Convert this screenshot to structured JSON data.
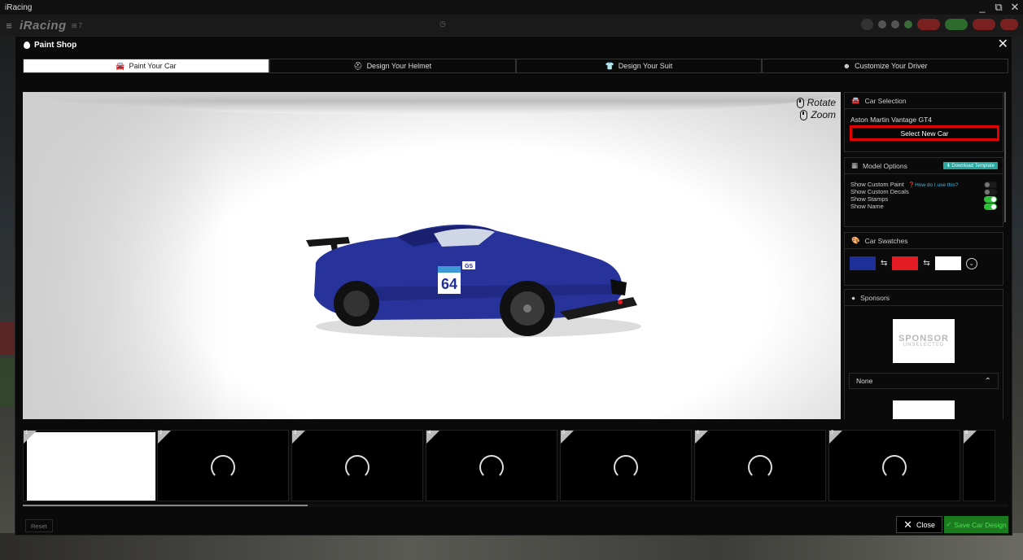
{
  "os_window": {
    "title": "iRacing",
    "minimize": "_",
    "restore": "⧉",
    "close": "✕"
  },
  "nav": {
    "logo": "iRacing",
    "logo_badge": "⊞ 7"
  },
  "modal": {
    "title": "Paint Shop",
    "close": "✕"
  },
  "tabs": [
    {
      "label": "Paint Your Car",
      "icon": "🚘",
      "active": true
    },
    {
      "label": "Design Your Helmet",
      "icon": "⛑",
      "active": false
    },
    {
      "label": "Design Your Suit",
      "icon": "👕",
      "active": false
    },
    {
      "label": "Customize Your Driver",
      "icon": "☻",
      "active": false
    }
  ],
  "viewport": {
    "rotate_label": "Rotate",
    "zoom_label": "Zoom",
    "car_number": "64",
    "car_badge": "GS"
  },
  "car_selection": {
    "header": "Car Selection",
    "car_name": "Aston Martin Vantage GT4",
    "select_button": "Select New Car"
  },
  "model_options": {
    "header": "Model Options",
    "download_template": "⬇ Download Template",
    "help_link": "How do I use this?",
    "options": [
      {
        "label": "Show Custom Paint",
        "on": false
      },
      {
        "label": "Show Custom Decals",
        "on": false
      },
      {
        "label": "Show Stamps",
        "on": true
      },
      {
        "label": "Show Name",
        "on": true
      }
    ]
  },
  "car_swatches": {
    "header": "Car Swatches",
    "colors": [
      "#1f2f9a",
      "#e51b24",
      "#ffffff"
    ],
    "swap": "⇆",
    "dropdown": "⌄"
  },
  "sponsors": {
    "header": "Sponsors",
    "placeholder_text": "SPONSOR",
    "placeholder_sub": "UNSELECTED",
    "selected": "None",
    "chevron": "⌃"
  },
  "thumbnails": [
    {
      "num": "1",
      "loaded": true
    },
    {
      "num": "2",
      "loaded": false
    },
    {
      "num": "3",
      "loaded": false
    },
    {
      "num": "4",
      "loaded": false
    },
    {
      "num": "5",
      "loaded": false
    },
    {
      "num": "6",
      "loaded": false
    },
    {
      "num": "7",
      "loaded": false
    },
    {
      "num": "8",
      "loaded": false
    }
  ],
  "footer": {
    "reset": "Reset",
    "close": "Close",
    "close_icon": "✕",
    "save": "Save Car Design",
    "save_icon": "✓"
  }
}
